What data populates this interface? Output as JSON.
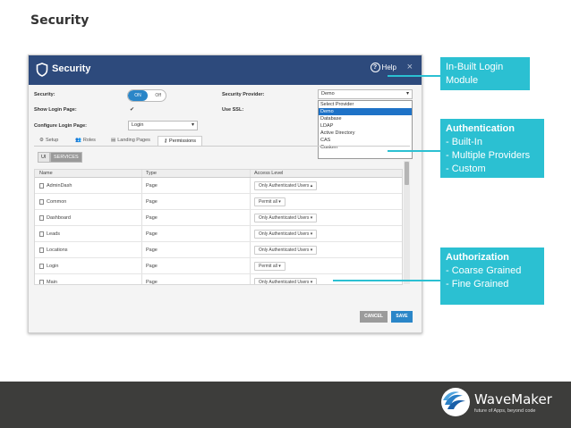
{
  "slide": {
    "title": "Security"
  },
  "dialog": {
    "title": "Security",
    "help": "Help",
    "close": "×",
    "security_label": "Security:",
    "toggle_on": "ON",
    "toggle_off": "Off",
    "show_login_label": "Show Login Page:",
    "show_login_checked": "✔",
    "configure_login_label": "Configure Login Page:",
    "login_select": "Login",
    "provider_label": "Security Provider:",
    "provider_value": "Demo",
    "ssl_label": "Use SSL:",
    "provider_options": [
      "Select Provider",
      "Demo",
      "Database",
      "LDAP",
      "Active Directory",
      "CAS",
      "Custom"
    ],
    "provider_selected_index": 1,
    "tabs": [
      {
        "label": "Setup",
        "icon": "gear-icon"
      },
      {
        "label": "Roles",
        "icon": "users-icon"
      },
      {
        "label": "Landing Pages",
        "icon": "folder-icon"
      },
      {
        "label": "Permissions",
        "icon": "key-icon"
      }
    ],
    "subtabs": [
      "UI",
      "SERVICES"
    ],
    "columns": [
      "Name",
      "Type",
      "Access Level"
    ],
    "rows": [
      {
        "name": "AdminDash",
        "type": "Page",
        "access": "Only Authenticated Users"
      },
      {
        "name": "Common",
        "type": "Page",
        "access": "Permit all"
      },
      {
        "name": "Dashboard",
        "type": "Page",
        "access": "Only Authenticated Users"
      },
      {
        "name": "Leads",
        "type": "Page",
        "access": "Only Authenticated Users"
      },
      {
        "name": "Locations",
        "type": "Page",
        "access": "Only Authenticated Users"
      },
      {
        "name": "Login",
        "type": "Page",
        "access": "Permit all"
      },
      {
        "name": "Main",
        "type": "Page",
        "access": "Only Authenticated Users"
      }
    ],
    "cancel": "CANCEL",
    "save": "SAVE"
  },
  "callouts": {
    "login_module": "In-Built Login Module",
    "auth_title": "Authentication",
    "auth_items": [
      "- Built-In",
      "- Multiple Providers",
      "- Custom"
    ],
    "authz_title": "Authorization",
    "authz_items": [
      "- Coarse Grained",
      "- Fine Grained"
    ]
  },
  "brand": {
    "name": "WaveMaker",
    "tagline": "future of Apps, beyond code"
  },
  "colors": {
    "header": "#2d4a7c",
    "callout": "#2bc0d2",
    "footer": "#3d3d3b",
    "primary": "#2a86c8"
  }
}
